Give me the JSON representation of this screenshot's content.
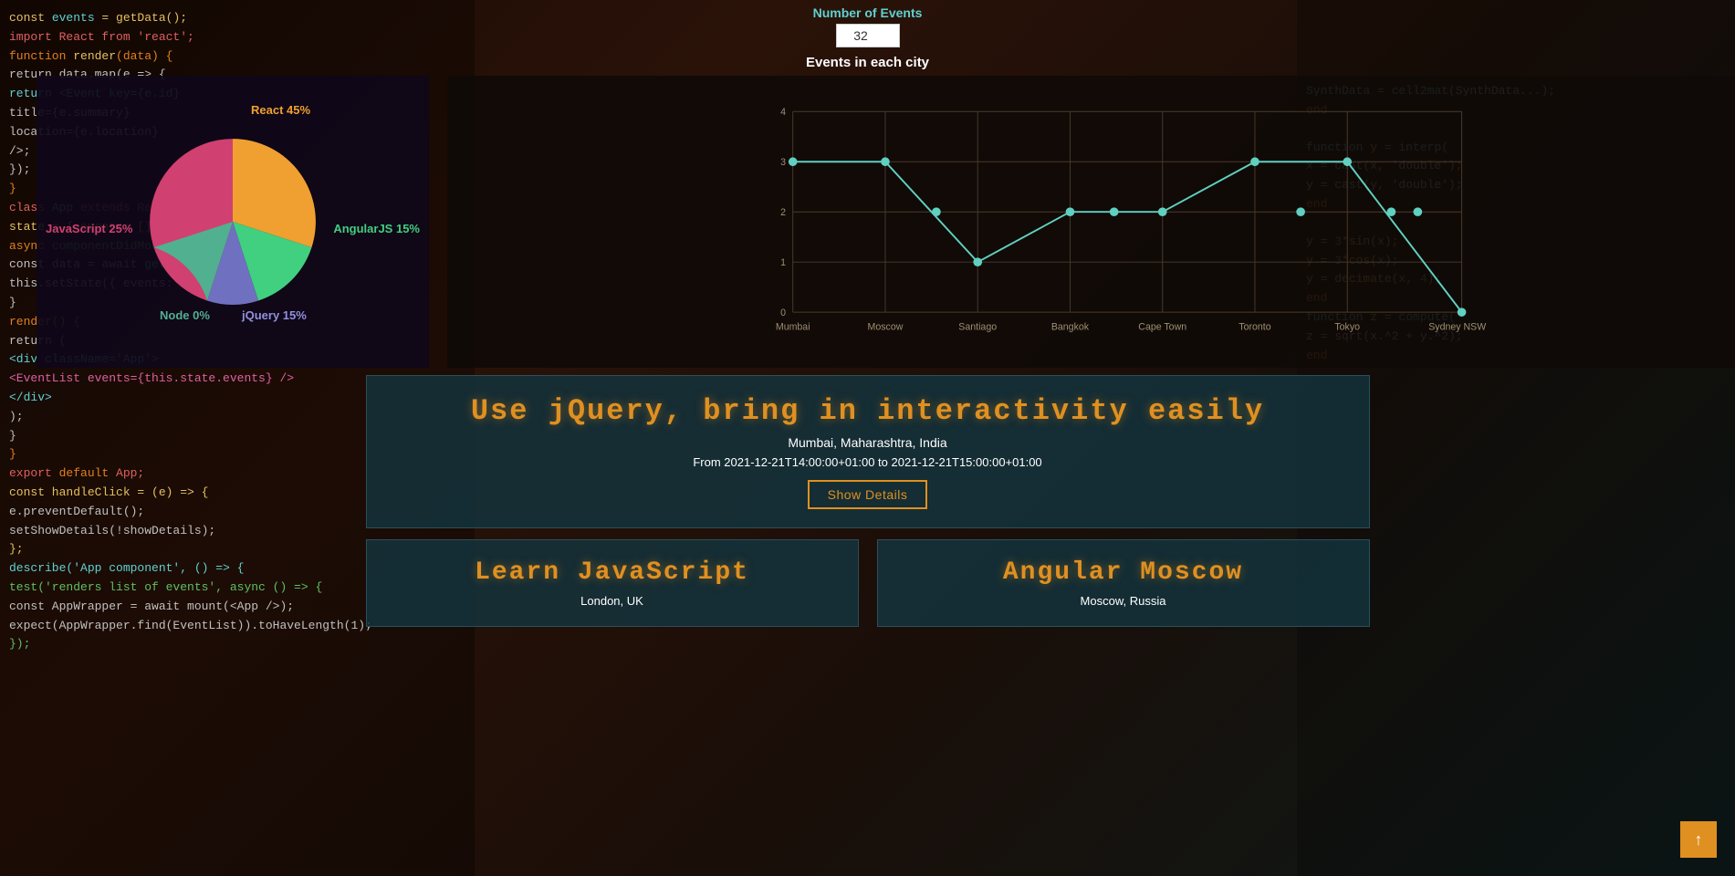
{
  "header": {
    "number_of_events_label": "Number of Events",
    "number_input_value": "32",
    "events_each_city_label": "Events in each city"
  },
  "pie_chart": {
    "segments": [
      {
        "name": "React",
        "percent": 45,
        "color": "#f0a030",
        "label": "React 45%"
      },
      {
        "name": "JavaScript",
        "percent": 25,
        "color": "#d04070",
        "label": "JavaScript 25%"
      },
      {
        "name": "Node",
        "percent": 0,
        "color": "#50b090",
        "label": "Node 0%"
      },
      {
        "name": "jQuery",
        "percent": 15,
        "color": "#7070c0",
        "label": "jQuery 15%"
      },
      {
        "name": "AngularJS",
        "percent": 15,
        "color": "#40d080",
        "label": "AngularJS 15%"
      }
    ]
  },
  "line_chart": {
    "y_axis": [
      0,
      1,
      2,
      3,
      4
    ],
    "x_labels": [
      "Mumbai",
      "Moscow",
      "Santiago",
      "Bangkok",
      "Cape Town",
      "Toronto",
      "Tokyo",
      "Sydney NSW"
    ],
    "data_points": [
      3,
      3,
      1,
      2,
      2,
      3,
      3,
      2,
      2,
      2,
      2,
      2,
      0
    ]
  },
  "event_cards": {
    "main_card": {
      "title": "Use jQuery, bring in interactivity easily",
      "location": "Mumbai, Maharashtra, India",
      "time_from": "From 2021-12-21T14:00:00+01:00 to 2021-12-21T15:00:00+01:00",
      "show_details_label": "Show Details"
    },
    "card_2": {
      "title": "Learn JavaScript",
      "location": "London, UK"
    },
    "card_3": {
      "title": "Angular Moscow",
      "location": "Moscow, Russia"
    }
  },
  "scroll_up_button": {
    "icon": "↑"
  },
  "bg_code": {
    "lines_left": [
      "const events = getData();",
      "function render(data) {",
      "  return data.map(e => {",
      "    return <Event key={e.id}",
      "      title={e.summary}",
      "      location={e.location}",
      "    />;",
      "  });",
      "}",
      "class App extends React.Component {",
      "  state = { events: [] };",
      "  async componentDidMount() {",
      "    const data = await getEvents();",
      "    this.setState({ events: data });",
      "  }",
      "  render() {",
      "    return (",
      "      <div className='App'>",
      "        <EventList events={this.state.events} />",
      "      </div>",
      "    );",
      "  }",
      "}",
      "export default App;"
    ],
    "lines_right": [
      "SynthData = cell2mat(",
      "end",
      "",
      "function y = interp(",
      "  x = cast(x, 'double');",
      "  y = cast(y, 'double');",
      "  end",
      "",
      "  y = decimate(",
      "  end"
    ]
  }
}
